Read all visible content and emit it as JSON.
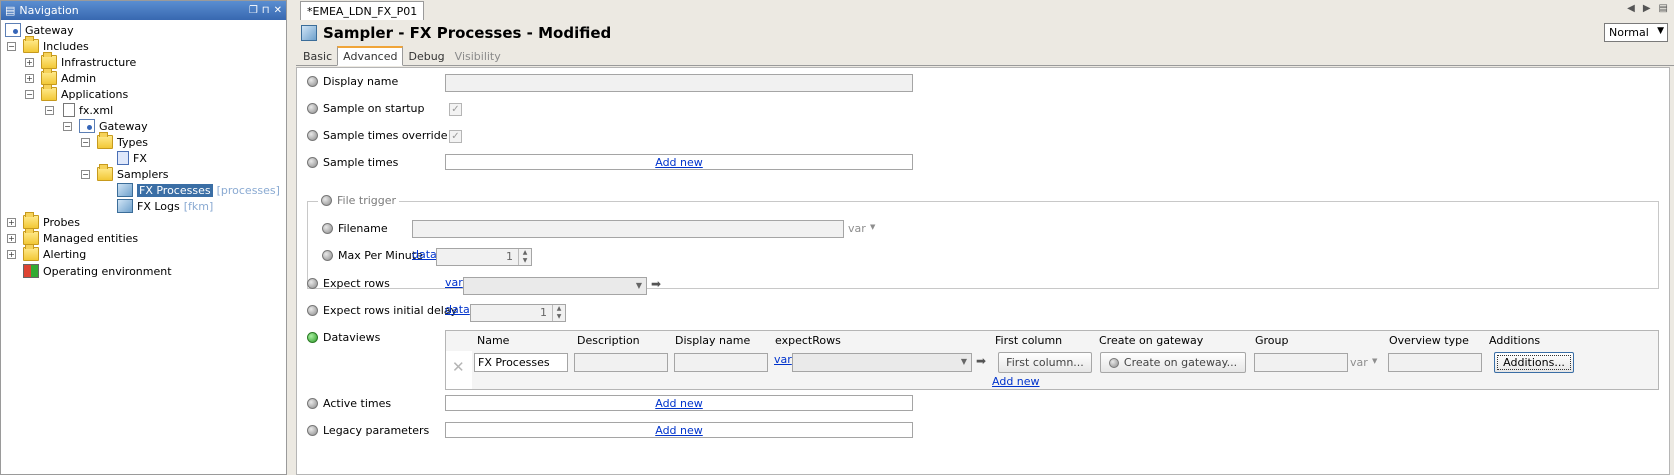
{
  "nav": {
    "title": "Navigation",
    "tree": {
      "gateway": "Gateway",
      "includes": "Includes",
      "infrastructure": "Infrastructure",
      "admin": "Admin",
      "applications": "Applications",
      "fx_xml": "fx.xml",
      "gateway_child": "Gateway",
      "types": "Types",
      "fx_type": "FX",
      "samplers": "Samplers",
      "fx_processes": "FX Processes",
      "fx_processes_hint": "[processes]",
      "fx_logs": "FX Logs",
      "fx_logs_hint": "[fkm]",
      "probes": "Probes",
      "managed_entities": "Managed entities",
      "alerting": "Alerting",
      "operating_environment": "Operating environment"
    }
  },
  "editor": {
    "doc_tab": "*EMEA_LDN_FX_P01",
    "title": "Sampler - FX Processes - Modified",
    "mode": "Normal",
    "tabs": [
      "Basic",
      "Advanced",
      "Debug",
      "Visibility"
    ],
    "fields": {
      "display_name": "Display name",
      "sample_on_startup": "Sample on startup",
      "sample_times_override": "Sample times override",
      "sample_times": "Sample times",
      "add_new": "Add new",
      "file_trigger": "File trigger",
      "filename": "Filename",
      "var": "var",
      "max_per_minute": "Max Per Minute",
      "data": "data",
      "max_per_minute_value": "1",
      "expect_rows": "Expect rows",
      "expect_rows_initial_delay": "Expect rows initial delay",
      "expect_rows_initial_delay_value": "1",
      "dataviews": "Dataviews",
      "active_times": "Active times",
      "legacy_parameters": "Legacy parameters"
    },
    "dataviews": {
      "headers": [
        "Name",
        "Description",
        "Display name",
        "expectRows",
        "First column",
        "Create on gateway",
        "Group",
        "Overview type",
        "Additions"
      ],
      "row": {
        "name": "FX Processes",
        "first_column_btn": "First column...",
        "create_on_gateway_btn": "Create on gateway...",
        "additions_btn": "Additions..."
      },
      "add_new": "Add new"
    }
  }
}
